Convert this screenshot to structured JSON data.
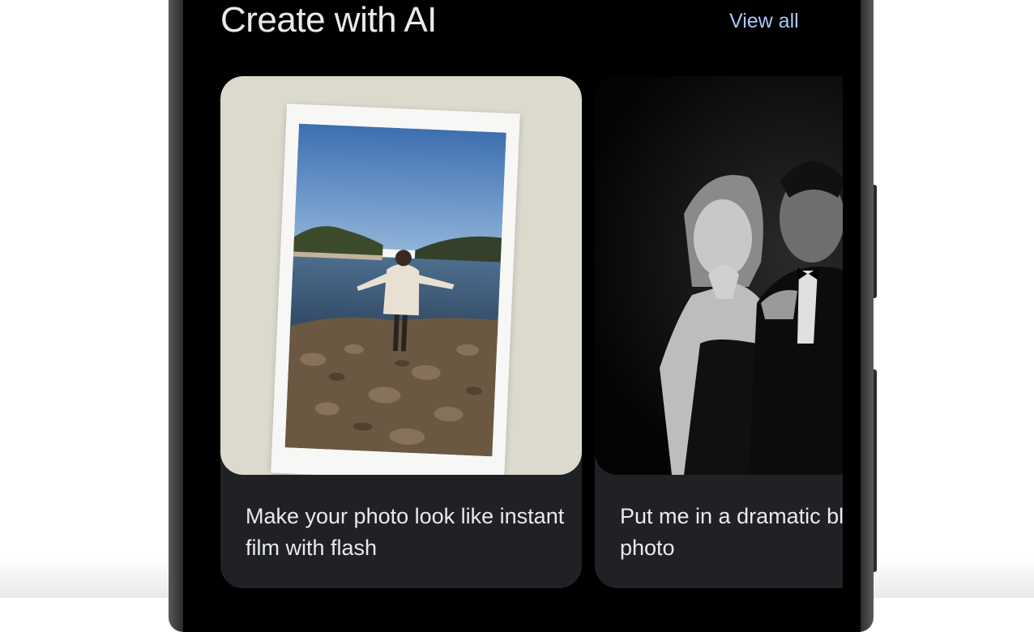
{
  "section": {
    "title": "Create with AI",
    "view_all_label": "View all"
  },
  "cards": [
    {
      "caption": "Make your photo look like instant film with flash",
      "image": "polaroid-lake-photo"
    },
    {
      "caption": "Put me in a dramatic black and white photo",
      "image": "bw-couple-portrait"
    }
  ],
  "colors": {
    "screen_bg": "#000000",
    "card_bg": "#202124",
    "link": "#a8c7fa",
    "text": "#e8eaed"
  }
}
